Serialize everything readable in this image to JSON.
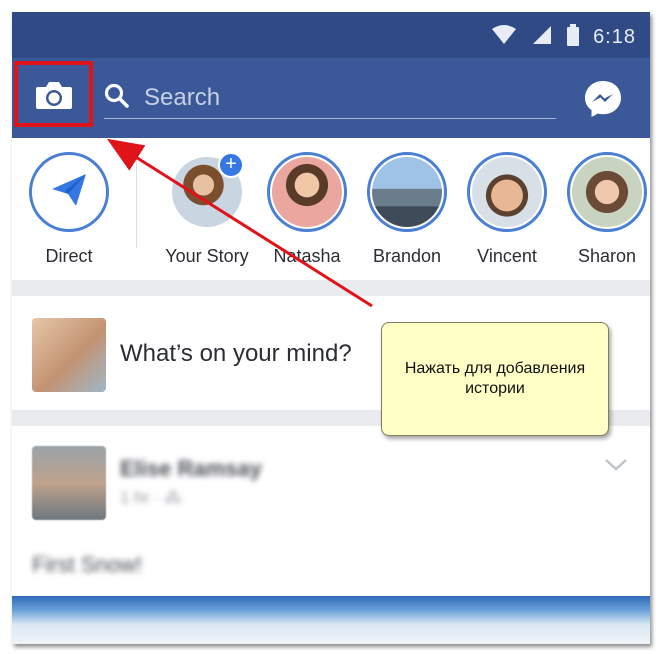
{
  "status_bar": {
    "time": "6:18",
    "icons": [
      "wifi-icon",
      "signal-icon",
      "battery-icon"
    ]
  },
  "header": {
    "camera_icon": "camera-icon",
    "search_placeholder": "Search",
    "messenger_icon": "messenger-icon"
  },
  "stories": [
    {
      "label": "Direct",
      "kind": "direct"
    },
    {
      "label": "Your Story",
      "kind": "own"
    },
    {
      "label": "Natasha",
      "kind": "friend"
    },
    {
      "label": "Brandon",
      "kind": "friend"
    },
    {
      "label": "Vincent",
      "kind": "friend"
    },
    {
      "label": "Sharon",
      "kind": "friend"
    }
  ],
  "composer": {
    "prompt": "What’s on your mind?"
  },
  "post": {
    "author": "Elise Ramsay",
    "meta": "1 hr · ⁂",
    "text": "First Snow!"
  },
  "annotation": {
    "text_line1": "Нажать для добавления",
    "text_line2": "истории"
  },
  "colors": {
    "facebook_blue": "#3b5998",
    "status_bar": "#2f4a85",
    "story_ring": "#4a7fd4",
    "highlight_red": "#e0131b",
    "note_yellow": "#ffffc6"
  }
}
